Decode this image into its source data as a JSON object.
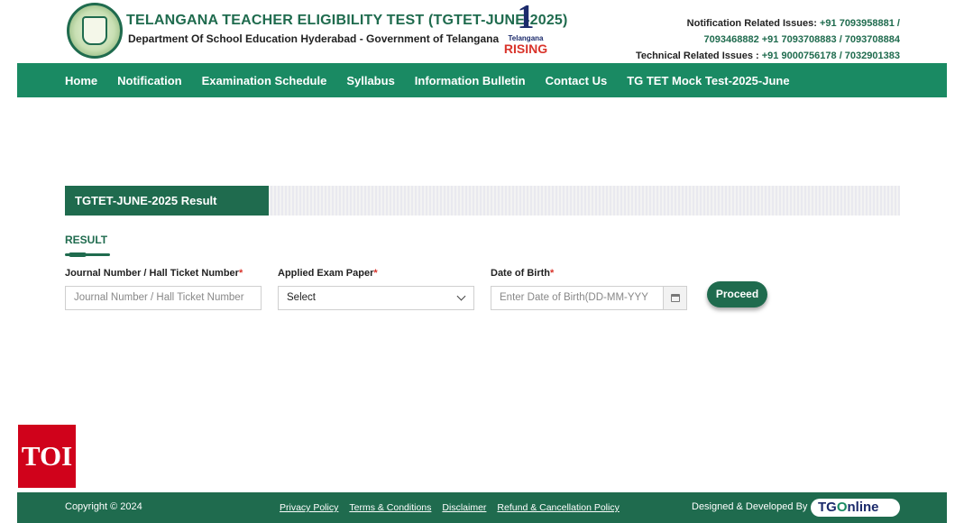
{
  "header": {
    "title": "TELANGANA TEACHER ELIGIBILITY TEST (TGTET-JUNE-2025)",
    "subtitle": "Department Of School Education Hyderabad - Government of Telangana",
    "rising_number": "1",
    "rising_line1": "Telangana",
    "rising_line2": "RISING",
    "contact_line1_label": "Notification Related Issues:",
    "contact_line1_nums": "+91 7093958881 /",
    "contact_line2_nums": "7093468882 +91 7093708883 / 7093708884",
    "contact_line3_label": "Technical Related Issues :",
    "contact_line3_nums": "+91 9000756178 / 7032901383"
  },
  "nav": {
    "items": [
      "Home",
      "Notification",
      "Examination Schedule",
      "Syllabus",
      "Information Bulletin",
      "Contact Us",
      "TG TET Mock Test-2025-June"
    ]
  },
  "result": {
    "tab_title": "TGTET-JUNE-2025 Result",
    "section_heading": "RESULT",
    "fields": {
      "hall_ticket": {
        "label": "Journal Number / Hall Ticket Number",
        "required_mark": "*",
        "placeholder": "Journal Number / Hall Ticket Number"
      },
      "exam_paper": {
        "label": "Applied Exam Paper",
        "required_mark": "*",
        "selected": "Select"
      },
      "dob": {
        "label": "Date of Birth",
        "required_mark": "*",
        "placeholder": "Enter Date of Birth(DD-MM-YYY"
      }
    },
    "proceed_label": "Proceed"
  },
  "watermark": {
    "text": "TOI"
  },
  "footer": {
    "copyright": "Copyright © 2024",
    "links": [
      "Privacy Policy",
      "Terms & Conditions",
      "Disclaimer",
      "Refund & Cancellation Policy"
    ],
    "designed_by": "Designed & Developed By",
    "brand_prefix": "TG",
    "brand_o": "O",
    "brand_suffix": "nline"
  },
  "colors": {
    "primary_green": "#1f6b4e",
    "nav_green": "#1a8a63",
    "required_red": "#d9342b",
    "toi_red": "#d0021b"
  },
  "icons": {
    "emblem": "telangana-emblem-icon",
    "rising_logo": "telangana-rising-logo",
    "dropdown": "chevron-down-icon",
    "calendar": "calendar-icon"
  }
}
